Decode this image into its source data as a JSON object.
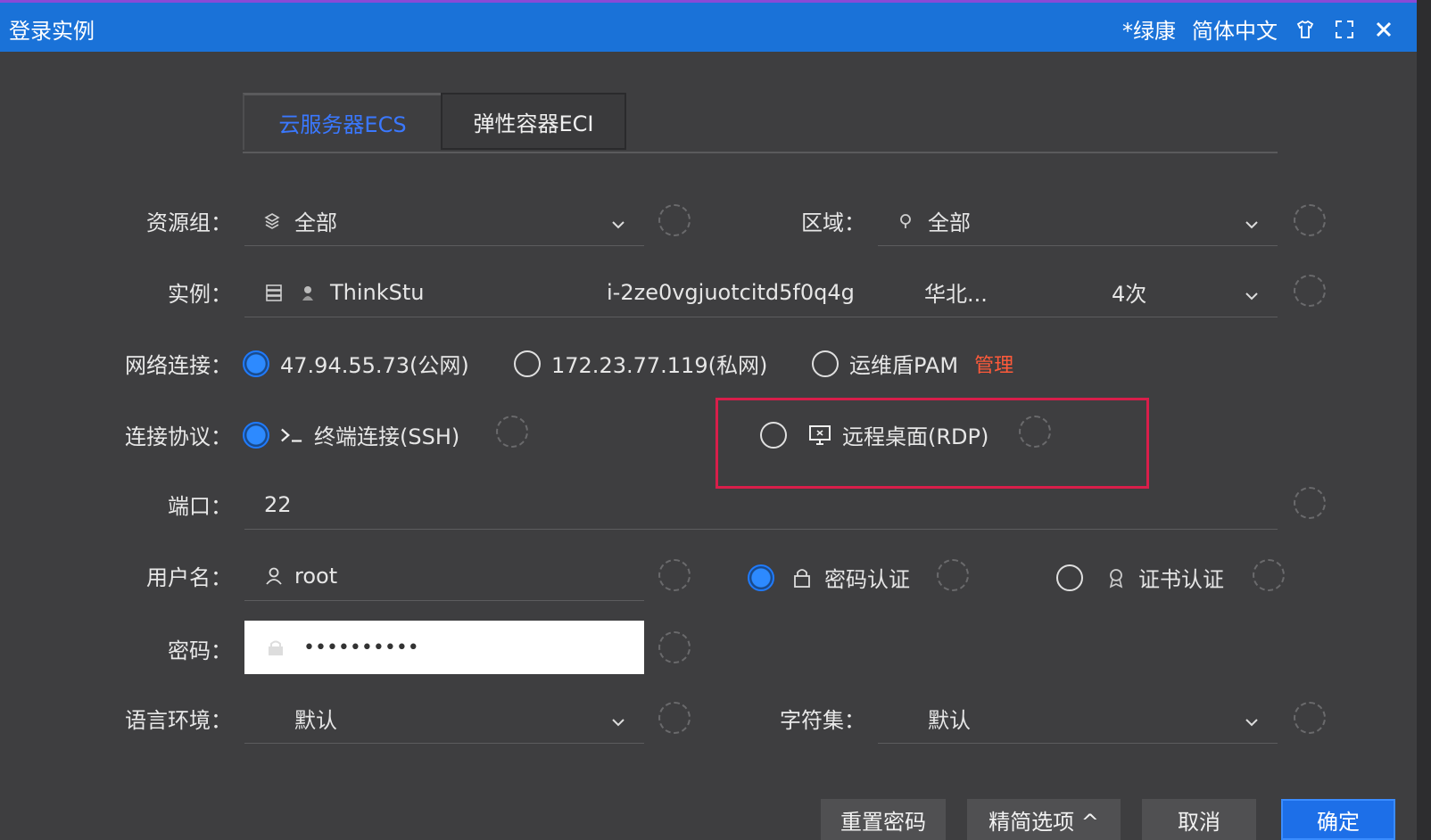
{
  "window": {
    "title": "登录实例",
    "user": "*绿康",
    "language": "简体中文"
  },
  "tabs": [
    {
      "label": "云服务器ECS",
      "active": true
    },
    {
      "label": "弹性容器ECI",
      "active": false
    }
  ],
  "form": {
    "resource_group": {
      "label": "资源组：",
      "value": "全部"
    },
    "region": {
      "label": "区域：",
      "value": "全部"
    },
    "instance": {
      "label": "实例：",
      "name": "ThinkStu",
      "id": "i-2ze0vgjuotcitd5f0q4g",
      "region": "华北...",
      "count": "4次"
    },
    "network": {
      "label": "网络连接：",
      "options": [
        {
          "label": "47.94.55.73(公网)",
          "selected": true
        },
        {
          "label": "172.23.77.119(私网)",
          "selected": false
        },
        {
          "label": "运维盾PAM",
          "selected": false,
          "badge": "管理"
        }
      ]
    },
    "protocol": {
      "label": "连接协议：",
      "options": [
        {
          "label": "终端连接(SSH)",
          "selected": true
        },
        {
          "label": "远程桌面(RDP)",
          "selected": false
        }
      ]
    },
    "port": {
      "label": "端口：",
      "value": "22"
    },
    "username": {
      "label": "用户名：",
      "value": "root"
    },
    "auth": {
      "options": [
        {
          "label": "密码认证",
          "selected": true
        },
        {
          "label": "证书认证",
          "selected": false
        }
      ]
    },
    "password": {
      "label": "密码：",
      "value": "••••••••••"
    },
    "locale": {
      "label": "语言环境：",
      "value": "默认"
    },
    "charset": {
      "label": "字符集：",
      "value": "默认"
    }
  },
  "buttons": {
    "reset_password": "重置密码",
    "simple_options": "精简选项 ^",
    "cancel": "取消",
    "confirm": "确定"
  },
  "colors": {
    "accent": "#1d6fe8",
    "highlight_box": "#d81e4a"
  }
}
